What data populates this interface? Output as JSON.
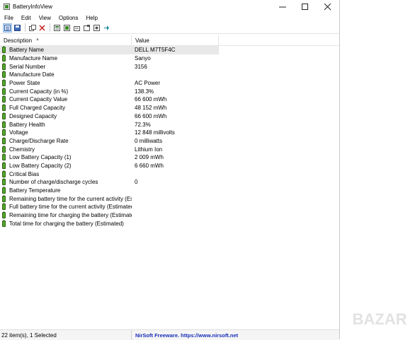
{
  "window": {
    "title": "BatteryInfoView"
  },
  "menu": [
    "File",
    "Edit",
    "View",
    "Options",
    "Help"
  ],
  "toolbar": {
    "icons": [
      "list-view-icon",
      "save-icon",
      "copy-icon",
      "delete-icon",
      "html-report-icon",
      "properties-icon",
      "refresh-icon",
      "find-icon",
      "options-icon",
      "exit-icon"
    ]
  },
  "columns": {
    "description": "Description",
    "value": "Value"
  },
  "rows": [
    {
      "description": "Battery Name",
      "value": "DELL M7T5F4C"
    },
    {
      "description": "Manufacture Name",
      "value": "Sanyo"
    },
    {
      "description": "Serial Number",
      "value": "3156"
    },
    {
      "description": "Manufacture Date",
      "value": ""
    },
    {
      "description": "Power State",
      "value": "AC Power"
    },
    {
      "description": "Current Capacity (in %)",
      "value": "138.3%"
    },
    {
      "description": "Current Capacity Value",
      "value": "66 600 mWh"
    },
    {
      "description": "Full Charged Capacity",
      "value": "48 152 mWh"
    },
    {
      "description": "Designed Capacity",
      "value": "66 600 mWh"
    },
    {
      "description": "Battery Health",
      "value": "72.3%"
    },
    {
      "description": "Voltage",
      "value": "12 848 millivolts"
    },
    {
      "description": "Charge/Discharge Rate",
      "value": "0 milliwatts"
    },
    {
      "description": "Chemistry",
      "value": "Lithium Ion"
    },
    {
      "description": "Low Battery Capacity (1)",
      "value": "2 009 mWh"
    },
    {
      "description": "Low Battery Capacity (2)",
      "value": "6 660 mWh"
    },
    {
      "description": "Critical Bias",
      "value": ""
    },
    {
      "description": "Number of charge/discharge cycles",
      "value": "0"
    },
    {
      "description": "Battery Temperature",
      "value": ""
    },
    {
      "description": "Remaining battery time for the current activity (Est...",
      "value": ""
    },
    {
      "description": "Full battery time for the current activity (Estimated)",
      "value": ""
    },
    {
      "description": "Remaining time for charging the battery (Estimated)",
      "value": ""
    },
    {
      "description": "Total  time for charging the battery (Estimated)",
      "value": ""
    }
  ],
  "status": {
    "count": "22 item(s), 1 Selected",
    "link": "NirSoft Freeware.  https://www.nirsoft.net"
  },
  "watermark": "BAZAR"
}
